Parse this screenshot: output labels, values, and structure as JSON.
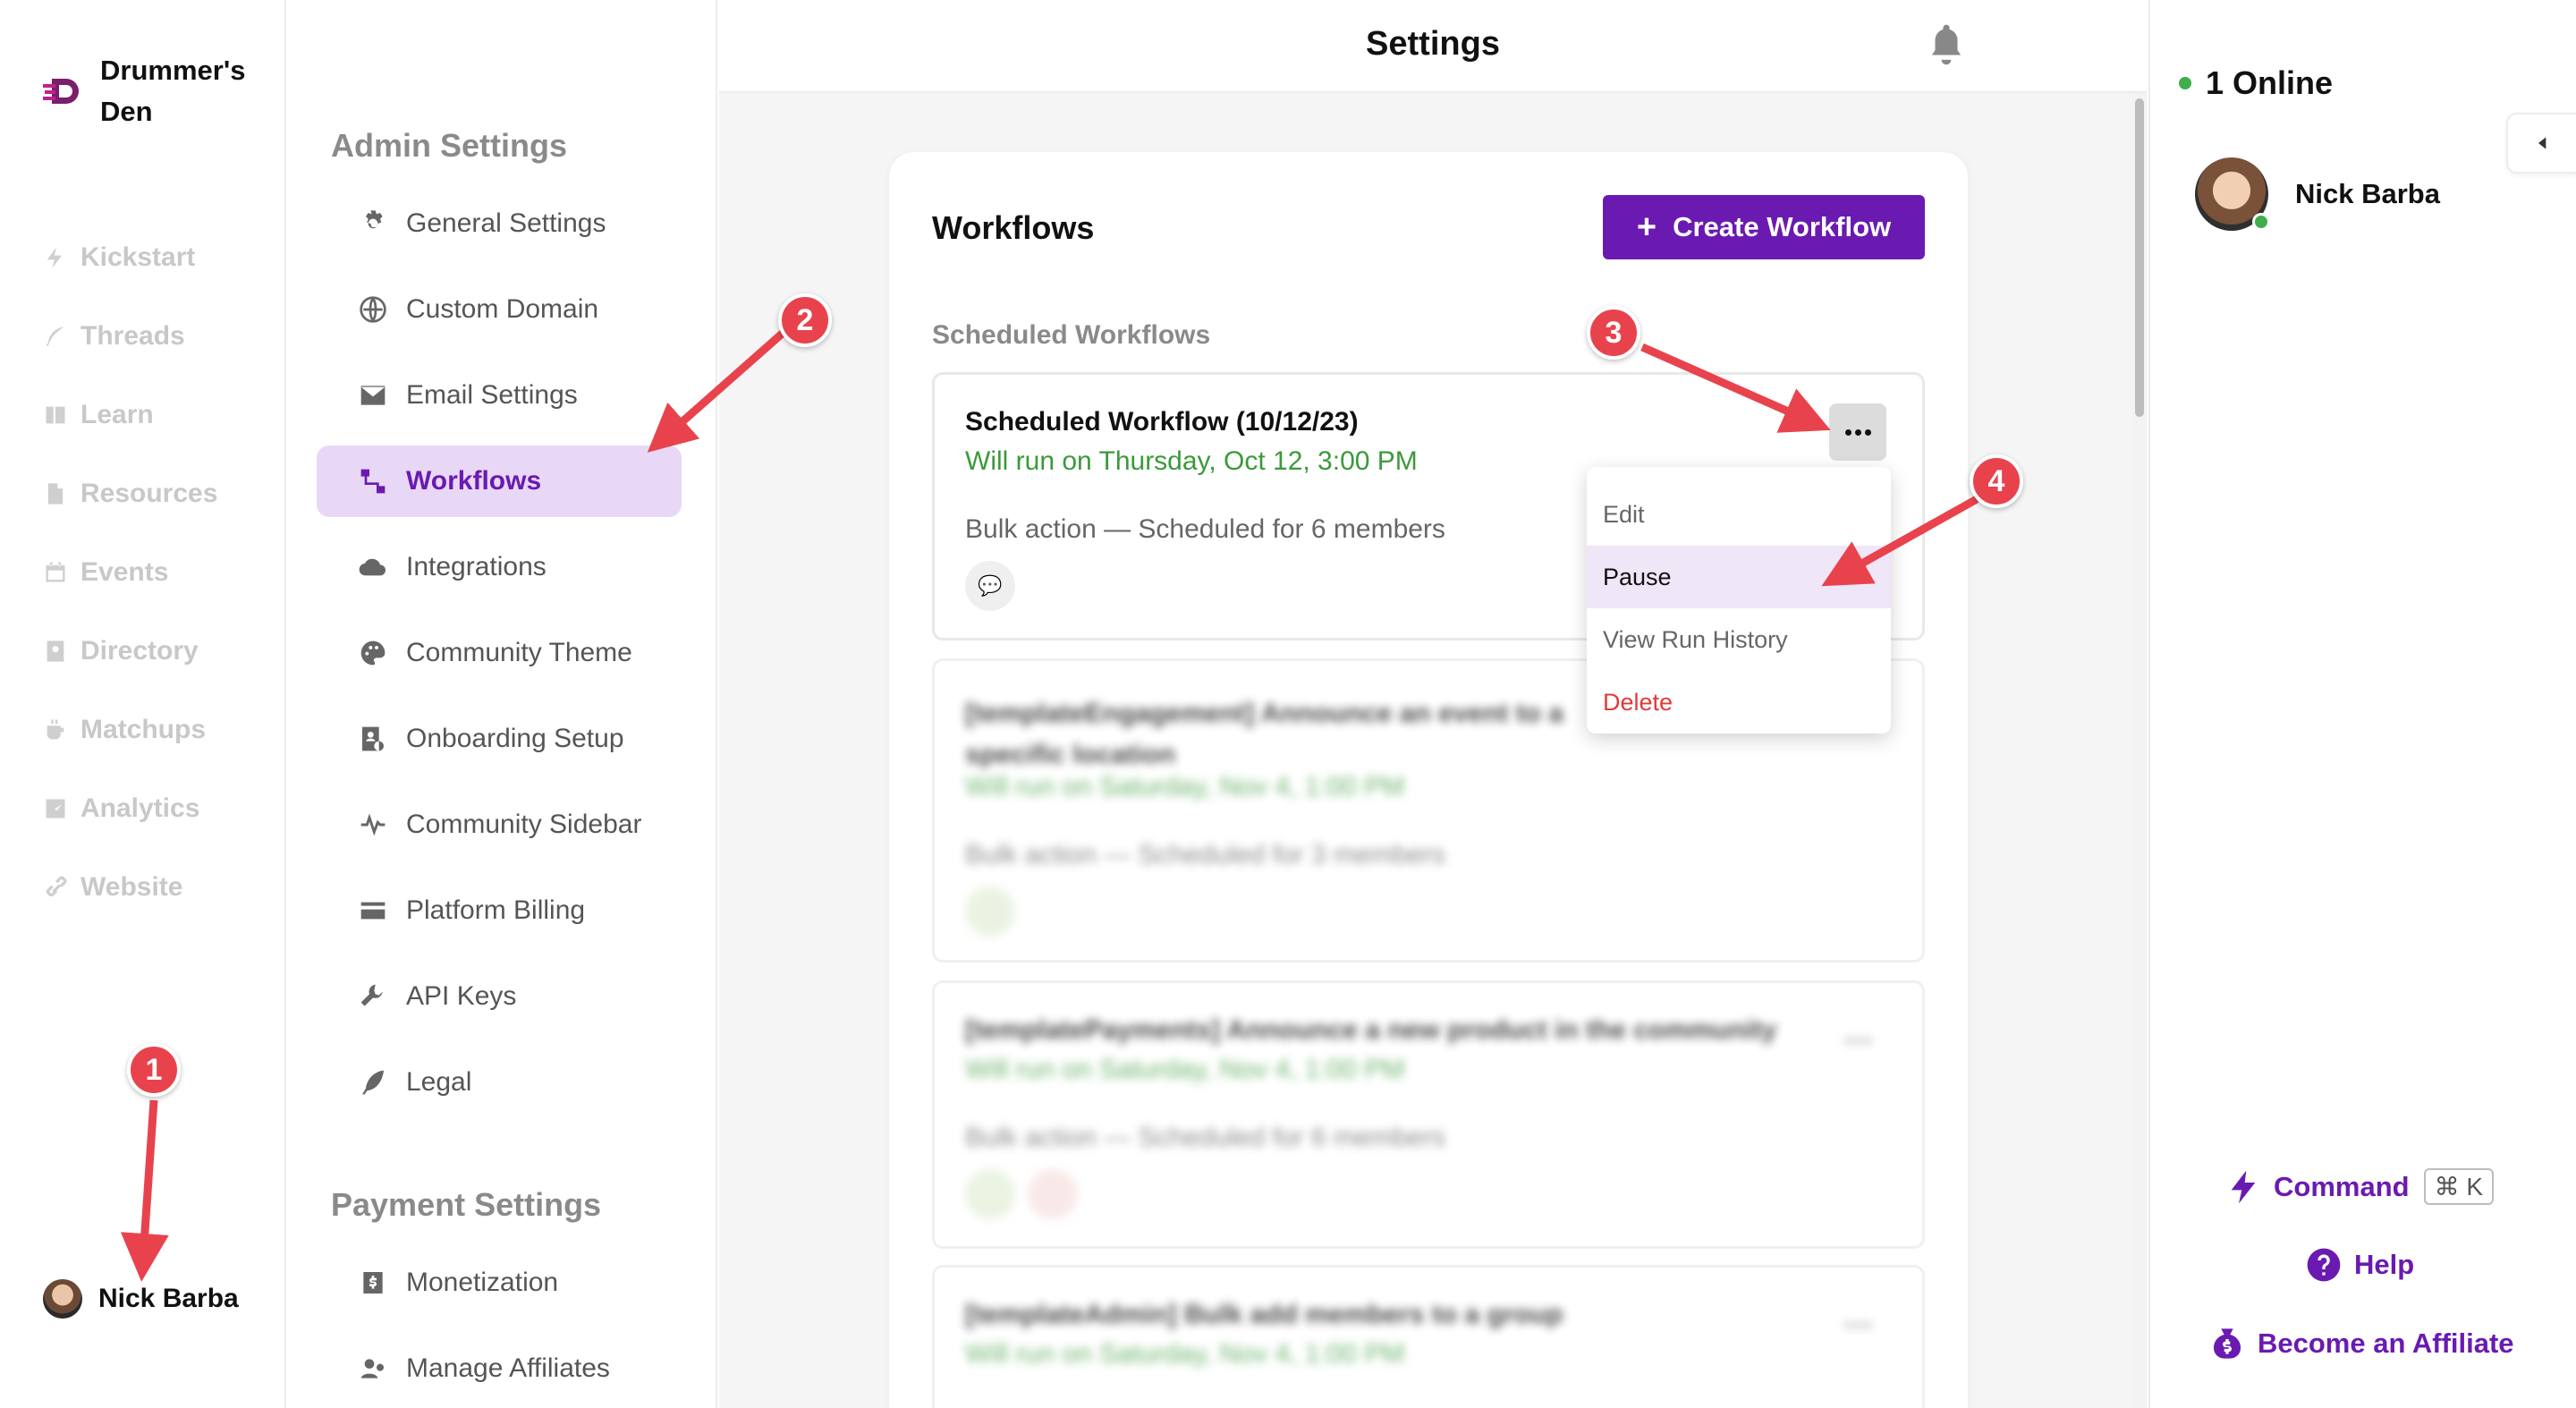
{
  "brand": {
    "name": "Drummer's Den"
  },
  "nav": {
    "items": [
      {
        "label": "Kickstart",
        "icon": "bolt-icon"
      },
      {
        "label": "Threads",
        "icon": "feather-icon"
      },
      {
        "label": "Learn",
        "icon": "book-icon"
      },
      {
        "label": "Resources",
        "icon": "document-icon"
      },
      {
        "label": "Events",
        "icon": "calendar-icon"
      },
      {
        "label": "Directory",
        "icon": "contacts-icon"
      },
      {
        "label": "Matchups",
        "icon": "coffee-icon"
      },
      {
        "label": "Analytics",
        "icon": "chart-icon"
      },
      {
        "label": "Website",
        "icon": "link-icon"
      }
    ],
    "user": {
      "name": "Nick Barba"
    }
  },
  "settings_menu": {
    "admin_heading": "Admin Settings",
    "items": [
      {
        "label": "General Settings",
        "icon": "gear-icon"
      },
      {
        "label": "Custom Domain",
        "icon": "globe-icon"
      },
      {
        "label": "Email Settings",
        "icon": "envelope-icon"
      },
      {
        "label": "Workflows",
        "icon": "workflow-icon",
        "active": true
      },
      {
        "label": "Integrations",
        "icon": "cloud-icon"
      },
      {
        "label": "Community Theme",
        "icon": "palette-icon"
      },
      {
        "label": "Onboarding Setup",
        "icon": "onboarding-icon"
      },
      {
        "label": "Community Sidebar",
        "icon": "pulse-icon"
      },
      {
        "label": "Platform Billing",
        "icon": "credit-card-icon"
      },
      {
        "label": "API Keys",
        "icon": "wrench-icon"
      },
      {
        "label": "Legal",
        "icon": "quill-icon"
      }
    ],
    "payment_heading": "Payment Settings",
    "payment_items": [
      {
        "label": "Monetization",
        "icon": "dollar-icon"
      },
      {
        "label": "Manage Affiliates",
        "icon": "affiliates-icon"
      }
    ]
  },
  "header": {
    "title": "Settings",
    "bell_icon": "bell-icon"
  },
  "workflows": {
    "title": "Workflows",
    "create_label": "Create Workflow",
    "section_label": "Scheduled Workflows",
    "cards": [
      {
        "name": "Scheduled Workflow (10/12/23)",
        "run": "Will run on Thursday, Oct 12, 3:00 PM",
        "bulk": "Bulk action — Scheduled for 6 members"
      },
      {
        "name": "[templateEngagement] Announce an event to a specific location",
        "run": "Will run on Saturday, Nov 4, 1:00 PM",
        "bulk": "Bulk action — Scheduled for 3 members"
      },
      {
        "name": "[templatePayments] Announce a new product in the community",
        "run": "Will run on Saturday, Nov 4, 1:00 PM",
        "bulk": "Bulk action — Scheduled for 6 members"
      },
      {
        "name": "[templateAdmin] Bulk add members to a group",
        "run": "Will run on Saturday, Nov 4, 1:00 PM",
        "bulk": ""
      }
    ],
    "menu": {
      "edit": "Edit",
      "pause": "Pause",
      "history": "View Run History",
      "delete": "Delete"
    }
  },
  "right_sidebar": {
    "online": "1 Online",
    "user": "Nick Barba",
    "command_label": "Command",
    "command_shortcut": "⌘ K",
    "help_label": "Help",
    "affiliate_label": "Become an Affiliate"
  },
  "annotations": {
    "b1": "1",
    "b2": "2",
    "b3": "3",
    "b4": "4"
  },
  "colors": {
    "accent": "#6a1ab1",
    "active_bg": "#e8d8f6",
    "success": "#3a9a3a",
    "danger": "#e03a3a",
    "annotation": "#e8434d"
  }
}
